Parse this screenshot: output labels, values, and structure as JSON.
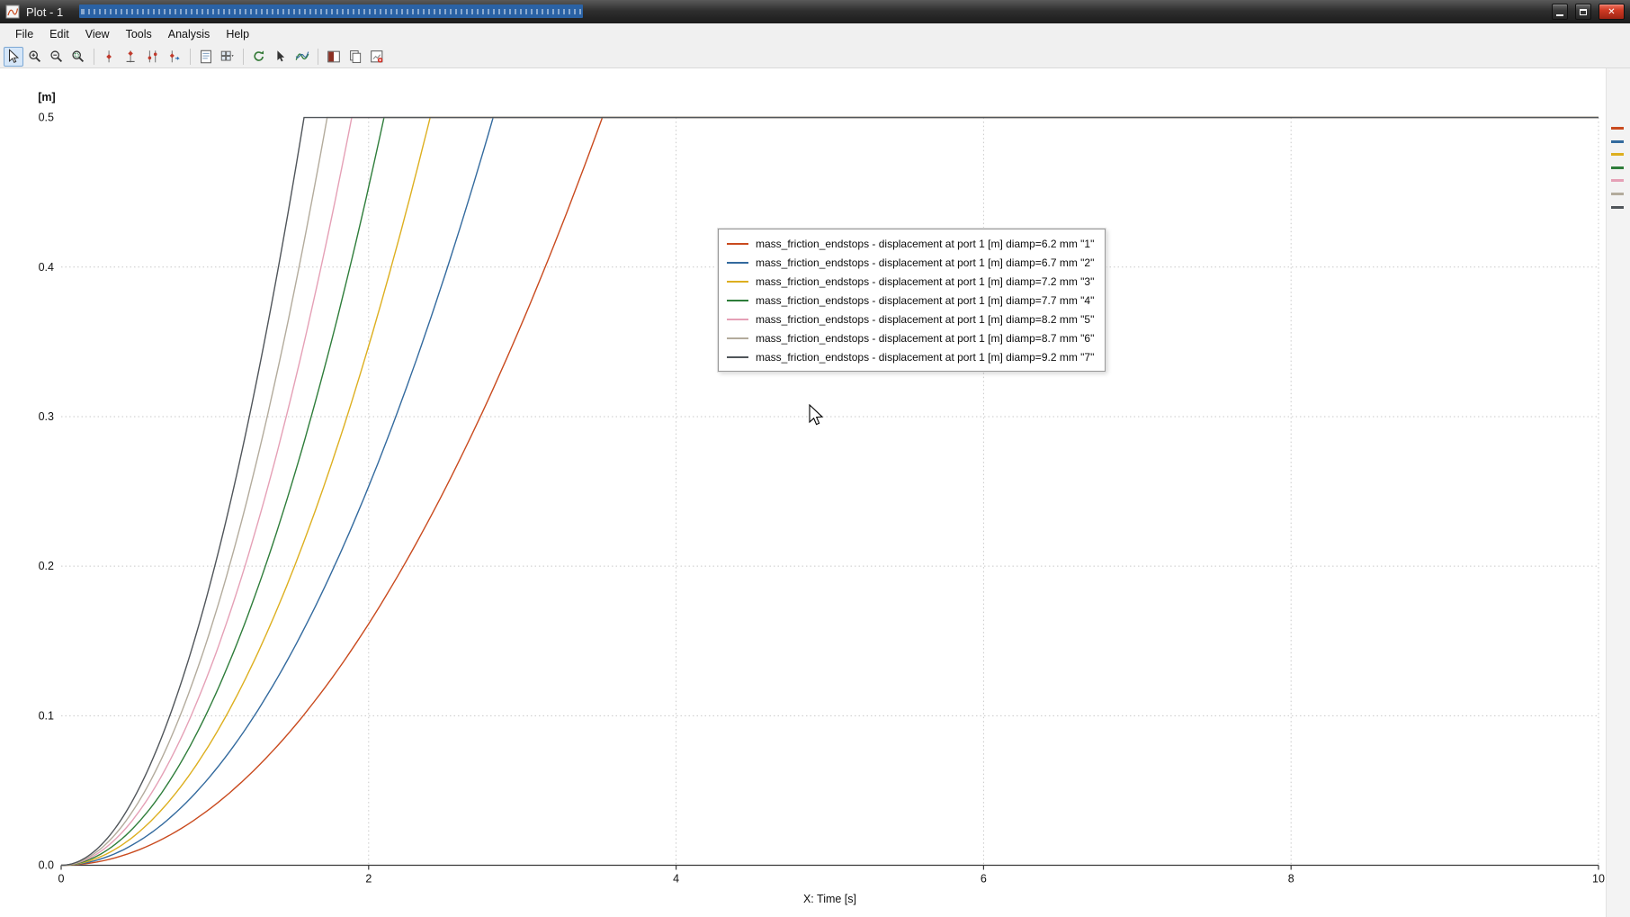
{
  "window": {
    "title": "Plot - 1",
    "controls": [
      {
        "name": "minimize-button",
        "glyph": "minimize"
      },
      {
        "name": "maximize-button",
        "glyph": "maximize"
      },
      {
        "name": "close-button",
        "glyph": "close",
        "close_glyph": "✕",
        "color": "#c2301b"
      }
    ]
  },
  "menu_bar": {
    "items": [
      "File",
      "Edit",
      "View",
      "Tools",
      "Analysis",
      "Help"
    ]
  },
  "toolbar": {
    "items": [
      {
        "type": "icon",
        "name": "select-cursor-icon",
        "active": true
      },
      {
        "type": "icon",
        "name": "zoom-in-icon"
      },
      {
        "type": "icon",
        "name": "zoom-out-icon"
      },
      {
        "type": "icon",
        "name": "zoom-region-icon"
      },
      {
        "type": "separator"
      },
      {
        "type": "icon",
        "name": "measure-cursor-icon"
      },
      {
        "type": "icon",
        "name": "marker-cursor-icon"
      },
      {
        "type": "icon",
        "name": "double-cursor-icon"
      },
      {
        "type": "icon",
        "name": "difference-cursor-icon"
      },
      {
        "type": "separator"
      },
      {
        "type": "icon",
        "name": "page-layout-icon"
      },
      {
        "type": "icon",
        "name": "grid-layout-icon"
      },
      {
        "type": "separator"
      },
      {
        "type": "icon",
        "name": "refresh-icon"
      },
      {
        "type": "icon",
        "name": "pick-arrow-icon"
      },
      {
        "type": "icon",
        "name": "curve-properties-icon"
      },
      {
        "type": "separator"
      },
      {
        "type": "icon",
        "name": "split-view-icon"
      },
      {
        "type": "icon",
        "name": "copy-icon"
      },
      {
        "type": "icon",
        "name": "export-icon"
      }
    ]
  },
  "right_panel": {
    "pin_icon": "pin-icon"
  },
  "chart_data": {
    "type": "line",
    "title": "",
    "ylabel": "[m]",
    "xlabel": "X: Time [s]",
    "xlim": [
      0,
      10
    ],
    "ylim": [
      0.0,
      0.5
    ],
    "xticks": [
      0,
      2,
      4,
      6,
      8,
      10
    ],
    "yticks": [
      0.0,
      0.1,
      0.2,
      0.3,
      0.4,
      0.5
    ],
    "grid": true,
    "legend_position": "center",
    "saturation_value": 0.5,
    "note": "Each displacement curve rises approximately quadratically from 0 m and clamps at the 0.5 m endstop; larger orifice diameter reaches the endstop sooner.",
    "series": [
      {
        "label": "mass_friction_endstops - displacement at port 1 [m] diamp=6.2 mm \"1\"",
        "color": "#c94a1e",
        "diamp_mm": 6.2,
        "t_reach_endstop_s": 3.52
      },
      {
        "label": "mass_friction_endstops - displacement at port 1 [m] diamp=6.7 mm \"2\"",
        "color": "#336a9e",
        "diamp_mm": 6.7,
        "t_reach_endstop_s": 2.81
      },
      {
        "label": "mass_friction_endstops - displacement at port 1 [m] diamp=7.2 mm \"3\"",
        "color": "#ddaf1f",
        "diamp_mm": 7.2,
        "t_reach_endstop_s": 2.4
      },
      {
        "label": "mass_friction_endstops - displacement at port 1 [m] diamp=7.7 mm \"4\"",
        "color": "#2e7d3a",
        "diamp_mm": 7.7,
        "t_reach_endstop_s": 2.1
      },
      {
        "label": "mass_friction_endstops - displacement at port 1 [m] diamp=8.2 mm \"5\"",
        "color": "#e5a0b6",
        "diamp_mm": 8.2,
        "t_reach_endstop_s": 1.89
      },
      {
        "label": "mass_friction_endstops - displacement at port 1 [m] diamp=8.7 mm \"6\"",
        "color": "#b3ab9c",
        "diamp_mm": 8.7,
        "t_reach_endstop_s": 1.73
      },
      {
        "label": "mass_friction_endstops - displacement at port 1 [m] diamp=9.2 mm \"7\"",
        "color": "#50555a",
        "diamp_mm": 9.2,
        "t_reach_endstop_s": 1.58
      }
    ]
  }
}
